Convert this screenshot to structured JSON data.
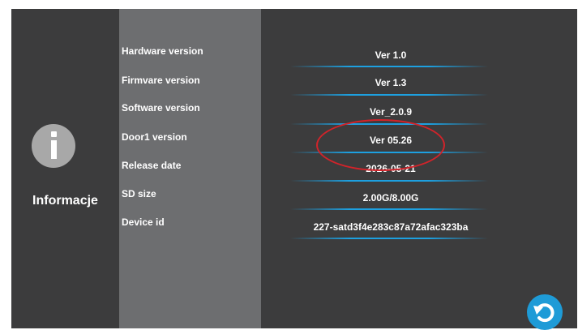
{
  "page": {
    "title": "Informacje"
  },
  "info": {
    "rows": [
      {
        "label": "Hardware version",
        "value": "Ver 1.0"
      },
      {
        "label": "Firmvare version",
        "value": "Ver 1.3"
      },
      {
        "label": "Software version",
        "value": "Ver_2.0.9"
      },
      {
        "label": "Door1 version",
        "value": "Ver 05.26"
      },
      {
        "label": "Release date",
        "value": "2026-05-21"
      },
      {
        "label": "SD size",
        "value": "2.00G/8.00G"
      },
      {
        "label": "Device id",
        "value": "227-satd3f4e283c87a72afac323ba"
      }
    ]
  },
  "icons": {
    "info": "info-icon",
    "refresh": "refresh-icon"
  },
  "colors": {
    "background": "#3c3c3d",
    "label_panel": "#6d6e70",
    "accent": "#1e9bd7",
    "highlight": "#d2232a"
  }
}
